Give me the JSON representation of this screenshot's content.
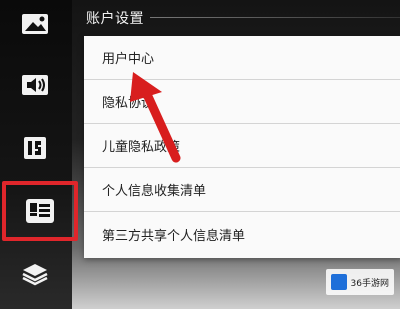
{
  "panel": {
    "title": "账户设置"
  },
  "menu": {
    "items": [
      {
        "label": "用户中心"
      },
      {
        "label": "隐私协议"
      },
      {
        "label": "儿童隐私政策"
      },
      {
        "label": "个人信息收集清单"
      },
      {
        "label": "第三方共享个人信息清单"
      }
    ]
  },
  "sidebar": {
    "icons": [
      "picture-icon",
      "sound-icon",
      "display-icon",
      "account-icon",
      "layers-icon"
    ],
    "active": "account-icon"
  },
  "watermark": {
    "text": "36手游网"
  },
  "colors": {
    "highlight": "#e0262b",
    "arrow": "#d81e1e",
    "menu_bg": "#fafafa"
  }
}
